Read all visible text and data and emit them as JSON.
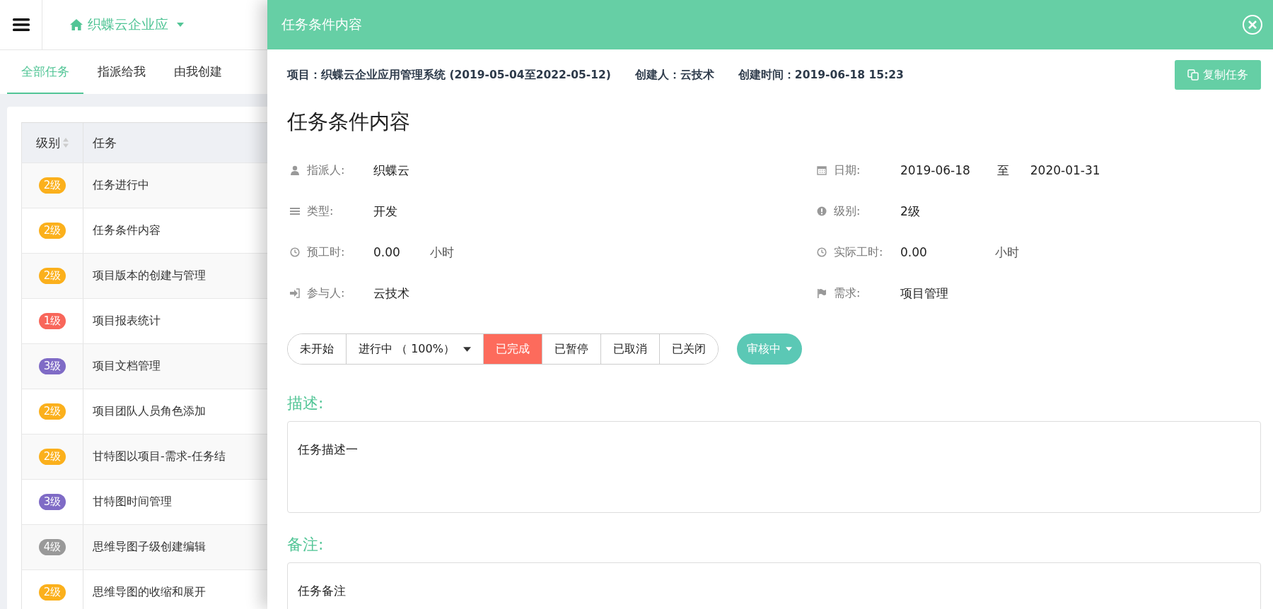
{
  "topbar": {
    "project": "织蝶云企业应"
  },
  "tabs": [
    {
      "label": "全部任务",
      "selected": true
    },
    {
      "label": "指派给我",
      "selected": false
    },
    {
      "label": "由我创建",
      "selected": false
    }
  ],
  "table": {
    "columns": [
      "级别",
      "任务"
    ],
    "rows": [
      {
        "level": "2级",
        "color": "#fbb01c",
        "task": "任务进行中"
      },
      {
        "level": "2级",
        "color": "#fbb01c",
        "task": "任务条件内容"
      },
      {
        "level": "2级",
        "color": "#fbb01c",
        "task": "项目版本的创建与管理"
      },
      {
        "level": "1级",
        "color": "#f8665a",
        "task": "项目报表统计"
      },
      {
        "level": "3级",
        "color": "#7f6bc6",
        "task": "项目文档管理"
      },
      {
        "level": "2级",
        "color": "#fbb01c",
        "task": "项目团队人员角色添加"
      },
      {
        "level": "2级",
        "color": "#fbb01c",
        "task": "甘特图以项目-需求-任务结"
      },
      {
        "level": "3级",
        "color": "#7f6bc6",
        "task": "甘特图时间管理"
      },
      {
        "level": "4级",
        "color": "#999999",
        "task": "思维导图子级创建编辑"
      },
      {
        "level": "2级",
        "color": "#fbb01c",
        "task": "思维导图的收缩和展开"
      }
    ]
  },
  "drawer": {
    "title": "任务条件内容",
    "meta": [
      {
        "label": "项目：",
        "value": "织蝶云企业应用管理系统 (2019-05-04至2022-05-12)"
      },
      {
        "label": "创建人：",
        "value": "云技术"
      },
      {
        "label": "创建时间：",
        "value": "2019-06-18 15:23"
      }
    ],
    "copy_button": "复制任务",
    "heading": "任务条件内容",
    "fields_left": [
      {
        "kind": "user",
        "label": "指派人:",
        "value": "织蝶云"
      },
      {
        "kind": "list",
        "label": "类型:",
        "value": "开发"
      },
      {
        "kind": "clock",
        "label": "预工时:",
        "value": "0.00",
        "unit": "小时"
      },
      {
        "kind": "signin",
        "label": "参与人:",
        "value": "云技术"
      }
    ],
    "fields_right": [
      {
        "kind": "calendar",
        "label": "日期:",
        "value": "2019-06-18",
        "sep": "至",
        "value2": "2020-01-31"
      },
      {
        "kind": "alert",
        "label": "级别:",
        "value": "2级"
      },
      {
        "kind": "clock",
        "label": "实际工时:",
        "value": "0.00",
        "unit": "小时"
      },
      {
        "kind": "flag",
        "label": "需求:",
        "value": "项目管理"
      }
    ],
    "statuses": [
      {
        "label": "未开始",
        "kind": "plain",
        "selected": false
      },
      {
        "label": "进行中 （ 100%）",
        "kind": "dropdown",
        "selected": false
      },
      {
        "label": "已完成",
        "kind": "plain",
        "selected": true
      },
      {
        "label": "已暂停",
        "kind": "plain",
        "selected": false
      },
      {
        "label": "已取消",
        "kind": "plain",
        "selected": false
      },
      {
        "label": "已关闭",
        "kind": "plain",
        "selected": false
      }
    ],
    "review_button": "审核中",
    "description": {
      "label": "描述:",
      "value": "任务描述一"
    },
    "remark": {
      "label": "备注:",
      "value": "任务备注"
    }
  }
}
